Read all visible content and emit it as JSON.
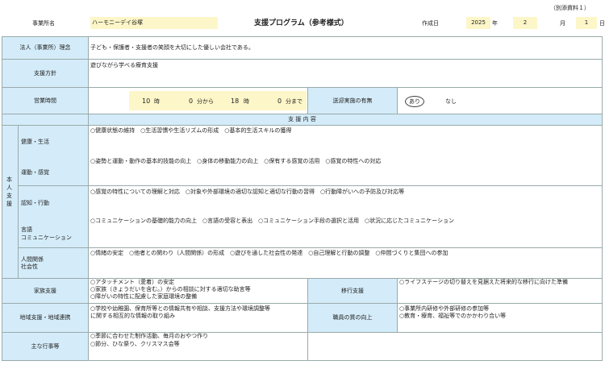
{
  "header": {
    "note": "（別添資料１）",
    "office_label": "事業所名",
    "office_name": "ハーモニーデイ谷塚",
    "title": "支援プログラム（参考様式）",
    "date_label": "作成日",
    "year": "2025",
    "year_unit": "年",
    "month": "2",
    "month_unit": "月",
    "day": "1",
    "day_unit": "日"
  },
  "philosophy": {
    "label": "法人（事業所）理念",
    "text": "子ども・保護者・支援者の笑顔を大切にした優しい会社である。"
  },
  "policy": {
    "label": "支援方針",
    "text": "遊びながら学べる療育支援"
  },
  "hours": {
    "label": "営業時間",
    "start_hour": "10",
    "hour_unit": "時",
    "start_min": "0",
    "min_from": "分から",
    "end_hour": "18",
    "hour_unit2": "時",
    "end_min": "0",
    "min_to": "分まで",
    "transport_label": "送迎実施の有無",
    "transport_yes": "あり",
    "transport_no": "なし"
  },
  "support_content_header": "支 援 内 容",
  "personal_support_label": "本人支援",
  "sections": [
    {
      "labels": [
        "健康・生活",
        "運動・感覚"
      ],
      "lines": [
        "○健康状態の維持　○生活習慣や生活リズムの形成　○基本的生活スキルの獲得",
        "○姿勢と運動・動作の基本的技能の向上　○身体の移動能力の向上　○保有する感覚の活用　○感覚の特性への対応"
      ]
    },
    {
      "labels": [
        "認知・行動",
        "言語",
        "コミュニケーション"
      ],
      "lines": [
        "○感覚の特性についての理解と対応　○対象や外部環境の適切な認知と適切な行動の習得　○行動障がいへの予防及び対応等",
        "○コミュニケーションの基礎的能力の向上　○言語の受容と表出　○コミュニケーション手段の選択と活用　○状況に応じたコミュニケーション"
      ]
    },
    {
      "labels": [
        "人間関係",
        "社会性"
      ],
      "lines": [
        "○情緒の安定　○他者との関わり（人間関係）の形成　○遊びを通した社会性の発達　○自己理解と行動の調整　○仲間づくりと集団への参加"
      ]
    }
  ],
  "family": {
    "label": "家族支援",
    "lines": [
      "○アタッチメント（愛着）の安定",
      "○家族（きょうだいを含む。）からの相談に対する適切な助言等",
      "○障がいの特性に配慮した家庭環境の整備"
    ]
  },
  "transition": {
    "label": "移行支援",
    "lines": [
      "○ライフステージの切り替えを見据えた将来的な移行に向けた準備"
    ]
  },
  "community": {
    "label": "地域支援・地域連携",
    "lines": [
      "○学校や幼稚園、保育所等との情報共有や相談、支援方法や環境調整等",
      "に関する相互的な情報の取り組み"
    ]
  },
  "staff": {
    "label": "職員の質の向上",
    "lines": [
      "○事業所内研修や外部研修の参加等",
      "○教育・療育、福祉等でのかかわり合い等"
    ]
  },
  "events": {
    "label": "主な行事等",
    "lines": [
      "○季節に合わせた制作活動、毎月のおやつ作り",
      "○節分、ひな祭り、クリスマス会等"
    ]
  }
}
